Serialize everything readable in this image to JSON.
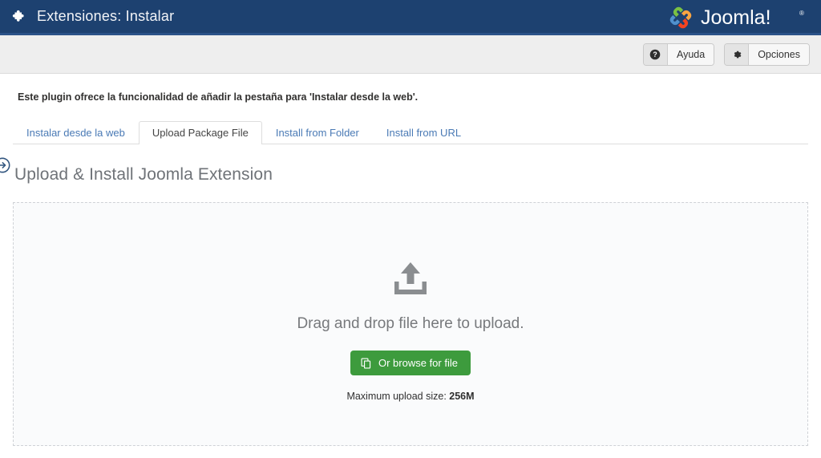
{
  "header": {
    "icon": "puzzle-piece-icon",
    "title": "Extensiones: Instalar",
    "brand": "Joomla!",
    "brand_icon": "joomla-logo-icon",
    "bg_color": "#1d4170"
  },
  "toolbar": {
    "buttons": [
      {
        "icon": "help-circle-icon",
        "label": "Ayuda"
      },
      {
        "icon": "gear-icon",
        "label": "Opciones"
      }
    ]
  },
  "sidebar_toggle": {
    "icon": "arrow-right-circle-icon"
  },
  "notice": {
    "text": "Este plugin ofrece la funcionalidad de añadir la pestaña para 'Instalar desde la web'."
  },
  "tabs": [
    {
      "label": "Instalar desde la web",
      "active": false
    },
    {
      "label": "Upload Package File",
      "active": true
    },
    {
      "label": "Install from Folder",
      "active": false
    },
    {
      "label": "Install from URL",
      "active": false
    }
  ],
  "main": {
    "heading": "Upload & Install Joomla Extension",
    "dropzone": {
      "icon": "upload-arrow-icon",
      "drop_text": "Drag and drop file here to upload.",
      "browse_button": {
        "icon": "copy-files-icon",
        "label": "Or browse for file",
        "color": "#3d9b3d"
      },
      "max_size_label": "Maximum upload size:",
      "max_size_value": "256M"
    }
  }
}
